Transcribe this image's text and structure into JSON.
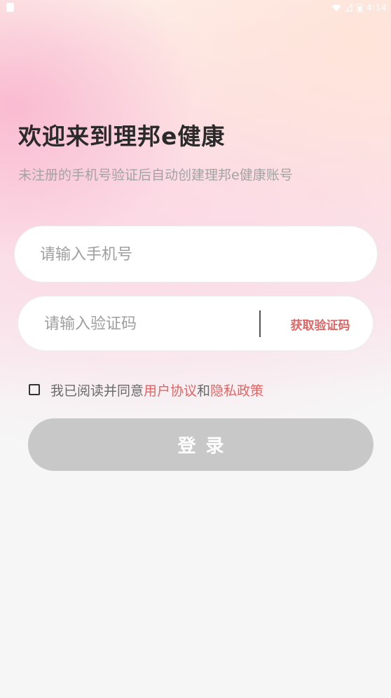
{
  "status_bar": {
    "time": "4:14",
    "icons": [
      "notification-icon",
      "wifi-icon",
      "signal-icon",
      "battery-icon"
    ]
  },
  "header": {
    "title": "欢迎来到理邦e健康",
    "subtitle": "未注册的手机号验证后自动创建理邦e健康账号"
  },
  "phone_field": {
    "value": "",
    "placeholder": "请输入手机号"
  },
  "code_field": {
    "value": "",
    "placeholder": "请输入验证码",
    "get_code_label": "获取验证码"
  },
  "agreement": {
    "checked": false,
    "prefix": "我已阅读并同意",
    "user_agreement": "用户协议",
    "conjunction": "和",
    "privacy_policy": "隐私政策"
  },
  "login": {
    "label": "登录"
  },
  "colors": {
    "accent": "#e06666",
    "title": "#2a2a2a",
    "subtitle": "#a3a3a3",
    "button_disabled": "#c8c8c8",
    "background": "#f6f6f6"
  }
}
